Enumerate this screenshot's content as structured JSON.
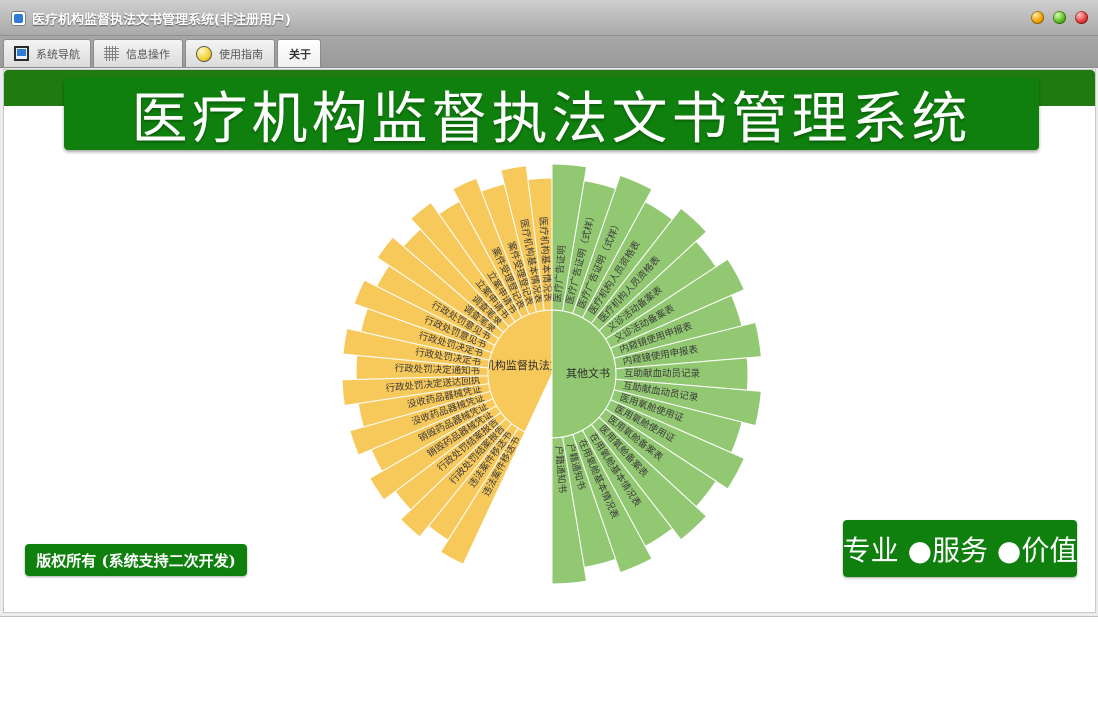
{
  "window": {
    "title": "医疗机构监督执法文书管理系统(非注册用户)"
  },
  "tabs": [
    {
      "label": "系统导航",
      "icon": "monitor-icon"
    },
    {
      "label": "信息操作",
      "icon": "grid-icon"
    },
    {
      "label": "使用指南",
      "icon": "clock-icon"
    },
    {
      "label": "关于",
      "icon": "",
      "active": true
    }
  ],
  "banner": {
    "title": "医疗机构监督执法文书管理系统"
  },
  "footer": {
    "copyright": "版权所有 (系统支持二次开发)",
    "slogan": "专业 ●服务 ●价值"
  },
  "chart_data": {
    "type": "sunburst",
    "root": "",
    "groups": [
      {
        "name": "医疗机构监督执法文书",
        "color": "#f7c85a",
        "items": [
          "违法案件移送书",
          "违法案件移送书",
          "行政处罚结案报告",
          "行政处罚结案报告",
          "销毁药品器械凭证",
          "销毁药品器械凭证",
          "没收药品器械凭证",
          "没收药品器械凭证",
          "行政处罚决定送达回执",
          "行政处罚决定通知书",
          "行政处罚决定书",
          "行政处罚决定书",
          "行政处罚意见书",
          "行政处罚意见书",
          "调查笔录",
          "调查笔录",
          "立案申请书",
          "立案申请书",
          "案件受理登记表",
          "案件受理登记表",
          "医疗机构基本情况表",
          "医疗机构基本情况表"
        ]
      },
      {
        "name": "其他文书",
        "color": "#93c873",
        "items": [
          "医疗广告证明",
          "医疗广告证明（式样）",
          "医疗广告证明（式样）",
          "医疗机构人员资格表",
          "医疗机构人员资格表",
          "义诊活动备案表",
          "义诊活动备案表",
          "内窥镜使用申报表",
          "内窥镜使用申报表",
          "互助献血动员记录",
          "互助献血动员记录",
          "医用氧舱使用证",
          "医用氧舱使用证",
          "医用氧舱备案表",
          "医用氧舱备案表",
          "在用氧舱基本情况表",
          "在用氧舱基本情况表",
          "户籍通知书",
          "户籍通知书"
        ]
      }
    ]
  }
}
